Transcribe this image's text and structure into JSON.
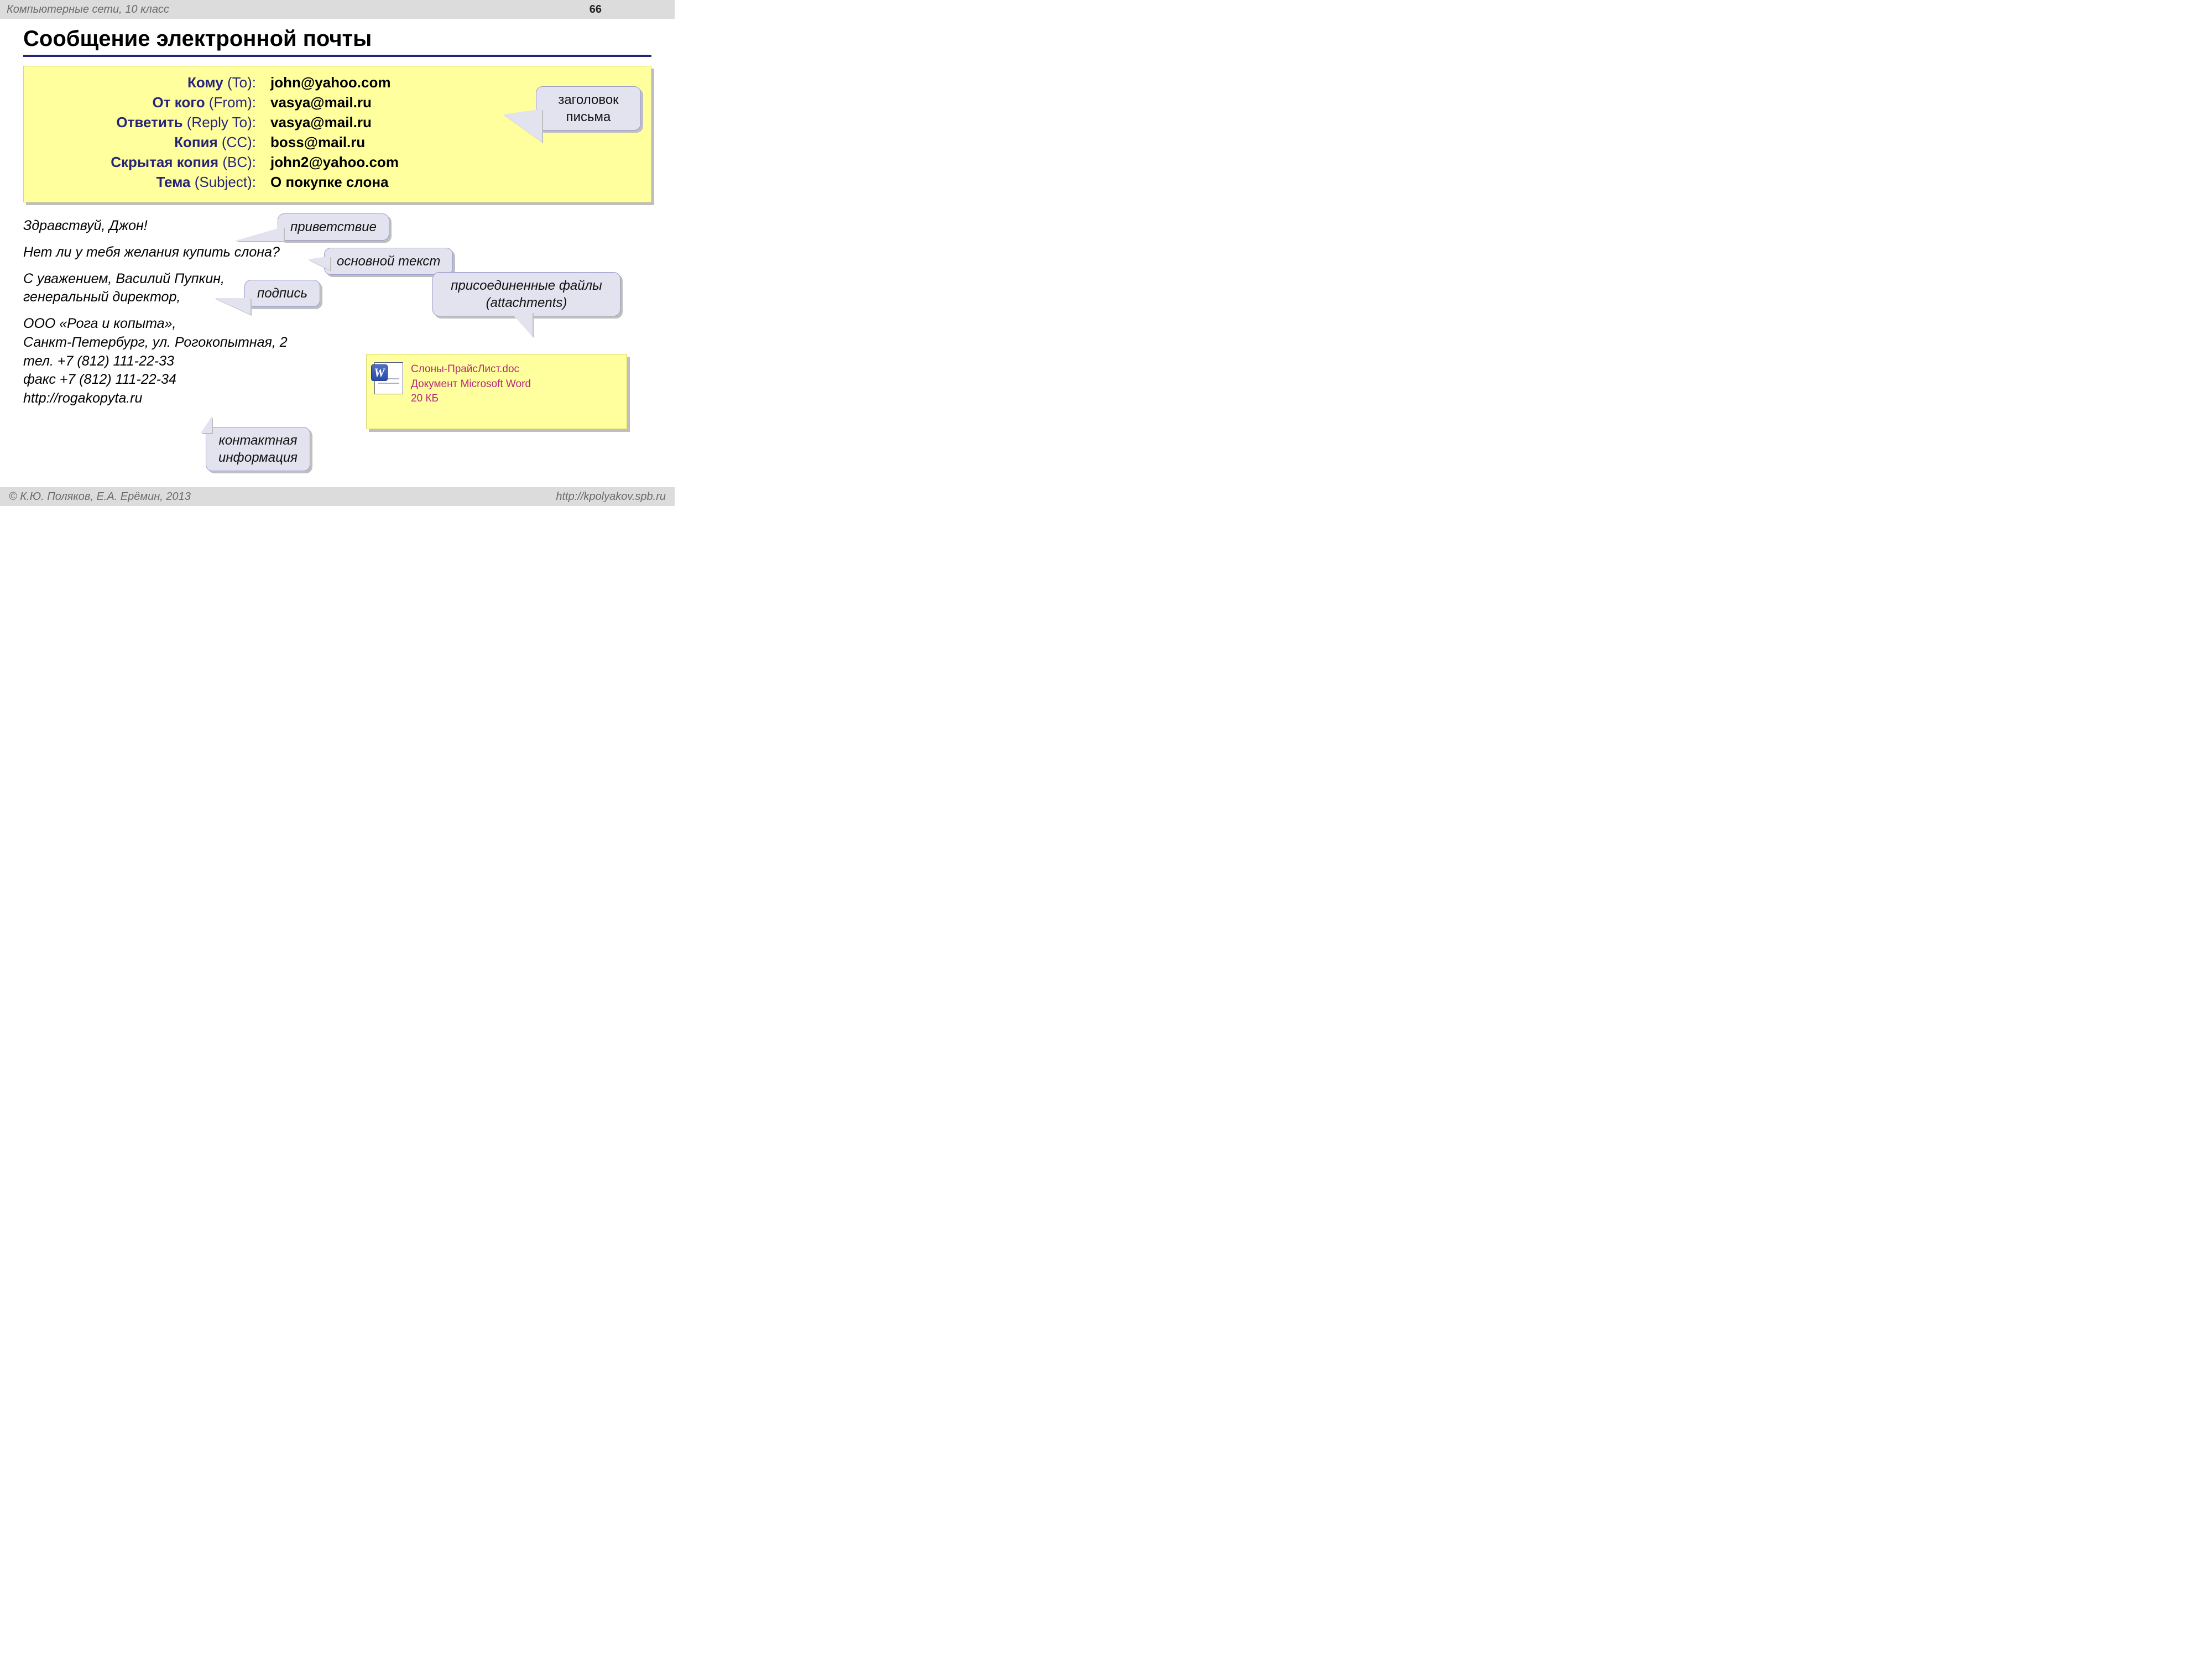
{
  "topbar": {
    "course": "Компьютерные сети, 10 класс",
    "page": "66"
  },
  "title": "Сообщение электронной почты",
  "headers": {
    "to": {
      "ru": "Кому",
      "en": " (To):",
      "value": "john@yahoo.com"
    },
    "from": {
      "ru": "От кого",
      "en": " (From):",
      "value": "vasya@mail.ru"
    },
    "reply": {
      "ru": "Ответить",
      "en": " (Reply To):",
      "value": "vasya@mail.ru"
    },
    "cc": {
      "ru": "Копия",
      "en": " (CC):",
      "value": "boss@mail.ru"
    },
    "bcc": {
      "ru": "Скрытая копия",
      "en": " (BC):",
      "value": "john2@yahoo.com"
    },
    "subject": {
      "ru": "Тема",
      "en": " (Subject):",
      "value": "О покупке слона"
    }
  },
  "callouts": {
    "header": "заголовок\nписьма",
    "greeting": "приветствие",
    "main": "основной текст",
    "signature": "подпись",
    "attach_label": "присоединенные файлы\n(attachments)",
    "contact": "контактная\nинформация"
  },
  "body": {
    "greeting": "Здравствуй, Джон!",
    "main": "Нет ли у тебя желания купить слона?",
    "sig1": "С уважением, Василий Пупкин,\nгенеральный директор,",
    "contact": "ООО «Рога и копыта»,\nСанкт-Петербург, ул. Рогокопытная, 2\nтел. +7 (812) 111-22-33\nфакс +7 (812) 111-22-34\nhttp://rogakopyta.ru"
  },
  "attachment": {
    "filename": "Слоны-ПрайсЛист.doc",
    "filetype": "Документ Microsoft Word",
    "filesize": "20 КБ"
  },
  "footer": {
    "left": "© К.Ю. Поляков, Е.А. Ерёмин, 2013",
    "right": "http://kpolyakov.spb.ru"
  }
}
